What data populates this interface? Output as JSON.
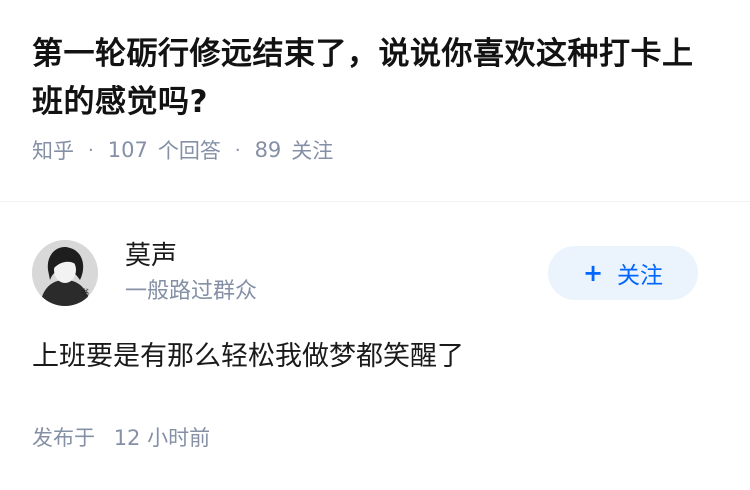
{
  "question": {
    "title": "第一轮砺行修远结束了，说说你喜欢这种打卡上班的感觉吗?",
    "source": "知乎",
    "answer_count": "107",
    "answer_label": "个回答",
    "follower_count": "89",
    "follower_label": "关注"
  },
  "answer": {
    "author_name": "莫声",
    "author_bio": "一般路过群众",
    "follow_button_label": "关注",
    "content": "上班要是有那么轻松我做梦都笑醒了",
    "publish_prefix": "发布于",
    "publish_time": "12 小时前"
  },
  "colors": {
    "accent": "#0066ff",
    "follow_bg": "#ebf3fc",
    "meta_text": "#8590a6"
  },
  "icons": {
    "follow": "plus-icon"
  }
}
